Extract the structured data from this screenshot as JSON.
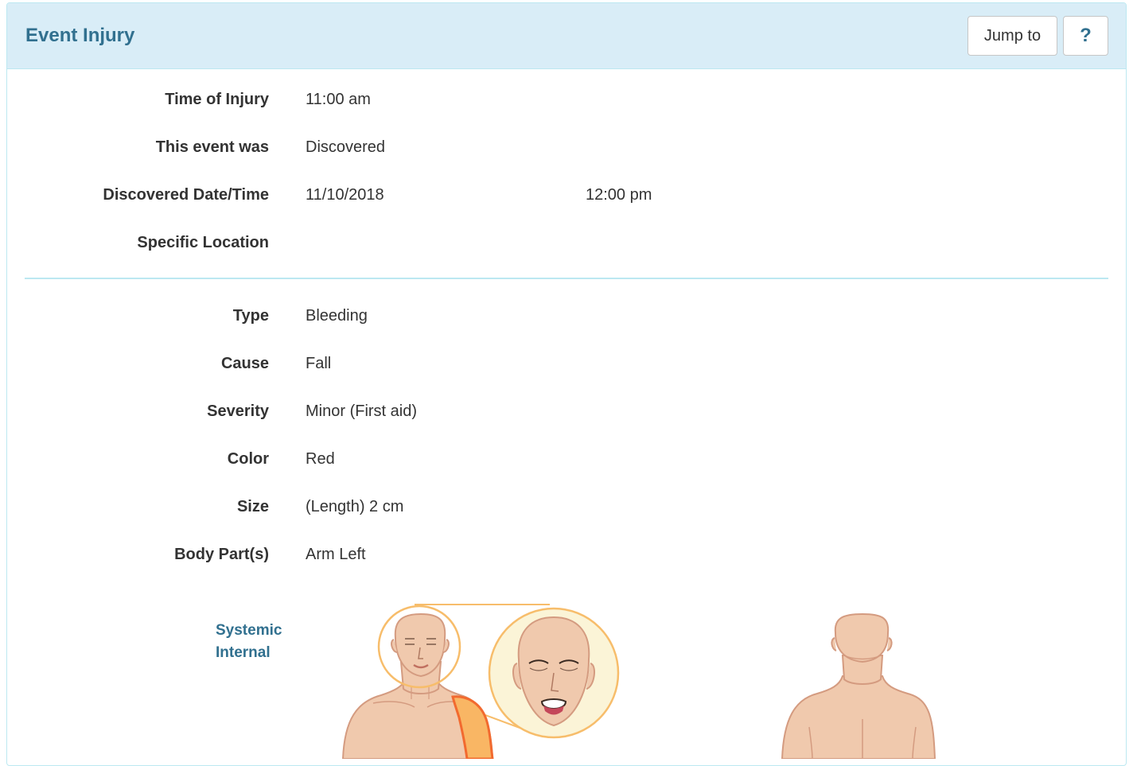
{
  "header": {
    "title": "Event Injury",
    "jump_label": "Jump to",
    "help_label": "?"
  },
  "event": {
    "time_label": "Time of Injury",
    "time_value": "11:00 am",
    "event_was_label": "This event was",
    "event_was_value": "Discovered",
    "discovered_label": "Discovered Date/Time",
    "discovered_date": "11/10/2018",
    "discovered_time": "12:00 pm",
    "location_label": "Specific Location",
    "location_value": ""
  },
  "injury": {
    "type_label": "Type",
    "type_value": "Bleeding",
    "cause_label": "Cause",
    "cause_value": "Fall",
    "severity_label": "Severity",
    "severity_value": "Minor (First aid)",
    "color_label": "Color",
    "color_value": "Red",
    "size_label": "Size",
    "size_value": "(Length) 2 cm",
    "body_parts_label": "Body Part(s)",
    "body_parts_value": "Arm Left"
  },
  "body_map": {
    "legend": [
      "Systemic",
      "Internal"
    ],
    "highlighted_part": "arm-left",
    "colors": {
      "skin": "#f0c9ad",
      "skin_outline": "#d49b80",
      "highlight_fill": "#f9b664",
      "highlight_outline": "#f26a2f",
      "zoom_ring": "#f7bd6b",
      "zoom_fill": "#fbf4d7"
    }
  }
}
